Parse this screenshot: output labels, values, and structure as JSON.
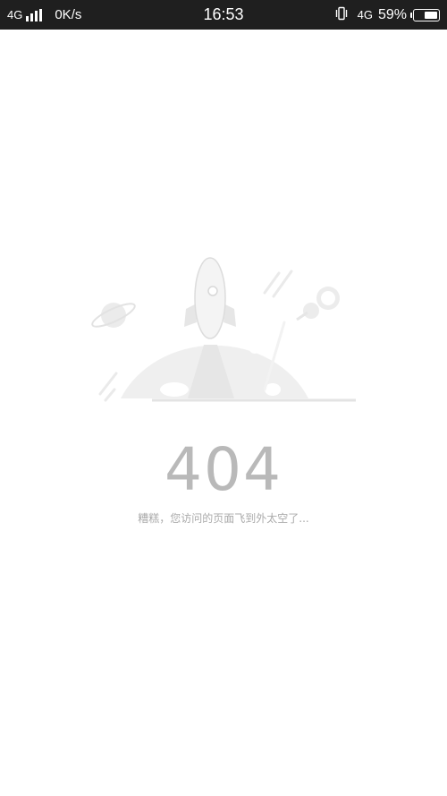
{
  "status_bar": {
    "network_left": "4G",
    "net_speed": "0K/s",
    "time": "16:53",
    "network_right": "4G",
    "battery_percent": "59%",
    "battery_level": 0.59,
    "icons": [
      "signal-icon",
      "vibrate-icon",
      "battery-icon"
    ]
  },
  "error_page": {
    "code": "404",
    "message": "糟糕，您访问的页面飞到外太空了...",
    "illustration": "rocket-planet-illustration"
  },
  "colors": {
    "status_bar_bg": "#1f1f1f",
    "background": "#ffffff",
    "error_code": "#b9b9b9",
    "message_text": "#aaaaaa",
    "illustration": "#e8e8e8"
  }
}
